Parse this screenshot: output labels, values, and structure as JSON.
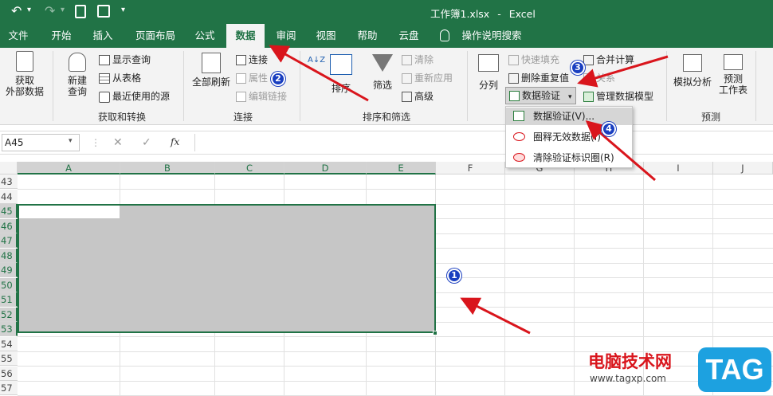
{
  "title": {
    "doc": "工作簿1.xlsx",
    "sep": "-",
    "app": "Excel"
  },
  "qat": {
    "undo": "↶",
    "redo": "↷",
    "dropdown": "▾"
  },
  "tabs": [
    "文件",
    "开始",
    "插入",
    "页面布局",
    "公式",
    "数据",
    "审阅",
    "视图",
    "帮助",
    "云盘"
  ],
  "tell_me": "操作说明搜索",
  "ribbon": {
    "get_external": "获取\n外部数据",
    "new_query": "新建\n查询",
    "show_query": "显示查询",
    "from_table": "从表格",
    "recent_sources": "最近使用的源",
    "group_get": "获取和转换",
    "refresh_all": "全部刷新",
    "connections": "连接",
    "properties": "属性",
    "edit_links": "编辑链接",
    "group_connections": "连接",
    "sort_az": "A↓Z",
    "sort": "排序",
    "filter": "筛选",
    "clear": "清除",
    "reapply": "重新应用",
    "advanced": "高级",
    "group_sort": "排序和筛选",
    "text_to_columns": "分列",
    "flash_fill": "快速填充",
    "remove_duplicates": "删除重复值",
    "data_validation": "数据验证",
    "consolidate": "合并计算",
    "relationships": "关系",
    "manage_model": "管理数据模型",
    "what_if": "模拟分析",
    "forecast_sheet": "预测\n工作表",
    "group_forecast": "预测"
  },
  "dropdown_menu": [
    "数据验证(V)...",
    "圈释无效数据(I)",
    "清除验证标识圈(R)"
  ],
  "formula_bar": {
    "name_box": "A45",
    "fx": "fx",
    "cancel": "✕",
    "enter": "✓"
  },
  "columns": [
    "A",
    "B",
    "C",
    "D",
    "E",
    "F",
    "G",
    "H",
    "I",
    "J"
  ],
  "rows": [
    "43",
    "44",
    "45",
    "46",
    "47",
    "48",
    "49",
    "50",
    "51",
    "52",
    "53",
    "54",
    "55",
    "56",
    "57"
  ],
  "selected_columns": [
    "A",
    "B",
    "C",
    "D",
    "E"
  ],
  "selected_rows": [
    "45",
    "46",
    "47",
    "48",
    "49",
    "50",
    "51",
    "52",
    "53"
  ],
  "markers": [
    "1",
    "2",
    "3",
    "4"
  ],
  "watermark": {
    "text": "电脑技术网",
    "url": "www.tagxp.com",
    "tag": "TAG"
  },
  "colors": {
    "excel_green": "#217346",
    "selection_gray": "#c6c6c6",
    "arrow_red": "#d9151c",
    "marker_blue": "#1a3fc0"
  }
}
